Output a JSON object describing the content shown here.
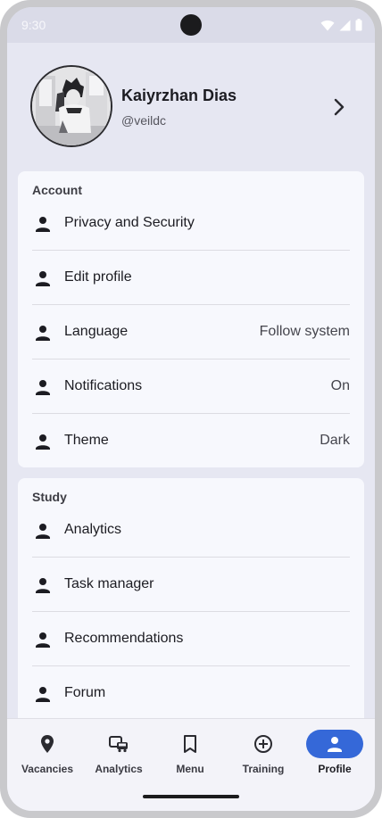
{
  "status_bar": {
    "time": "9:30",
    "icons": [
      "wifi-icon",
      "cellular-icon",
      "battery-icon"
    ]
  },
  "profile": {
    "name": "Kaiyrzhan Dias",
    "handle": "@veildc",
    "avatar": "avatar-image",
    "chevron_icon": "chevron-right-icon"
  },
  "account": {
    "title": "Account",
    "items": [
      {
        "label": "Privacy and Security",
        "value": "",
        "icon": "person-icon"
      },
      {
        "label": "Edit profile",
        "value": "",
        "icon": "person-icon"
      },
      {
        "label": "Language",
        "value": "Follow system",
        "icon": "person-icon"
      },
      {
        "label": "Notifications",
        "value": "On",
        "icon": "person-icon"
      },
      {
        "label": "Theme",
        "value": "Dark",
        "icon": "person-icon"
      }
    ]
  },
  "study": {
    "title": "Study",
    "items": [
      {
        "label": "Analytics",
        "icon": "person-icon"
      },
      {
        "label": "Task manager",
        "icon": "person-icon"
      },
      {
        "label": "Recommendations",
        "icon": "person-icon"
      },
      {
        "label": "Forum",
        "icon": "person-icon"
      }
    ]
  },
  "nav": {
    "items": [
      {
        "label": "Vacancies",
        "icon": "location-pin-icon",
        "active": false
      },
      {
        "label": "Analytics",
        "icon": "vehicles-icon",
        "active": false
      },
      {
        "label": "Menu",
        "icon": "bookmark-icon",
        "active": false
      },
      {
        "label": "Training",
        "icon": "add-circle-icon",
        "active": false
      },
      {
        "label": "Profile",
        "icon": "person-icon",
        "active": true
      }
    ]
  },
  "colors": {
    "background": "#e6e7f2",
    "card": "#f7f8fd",
    "accent": "#3568d8",
    "text": "#1c1c22"
  }
}
